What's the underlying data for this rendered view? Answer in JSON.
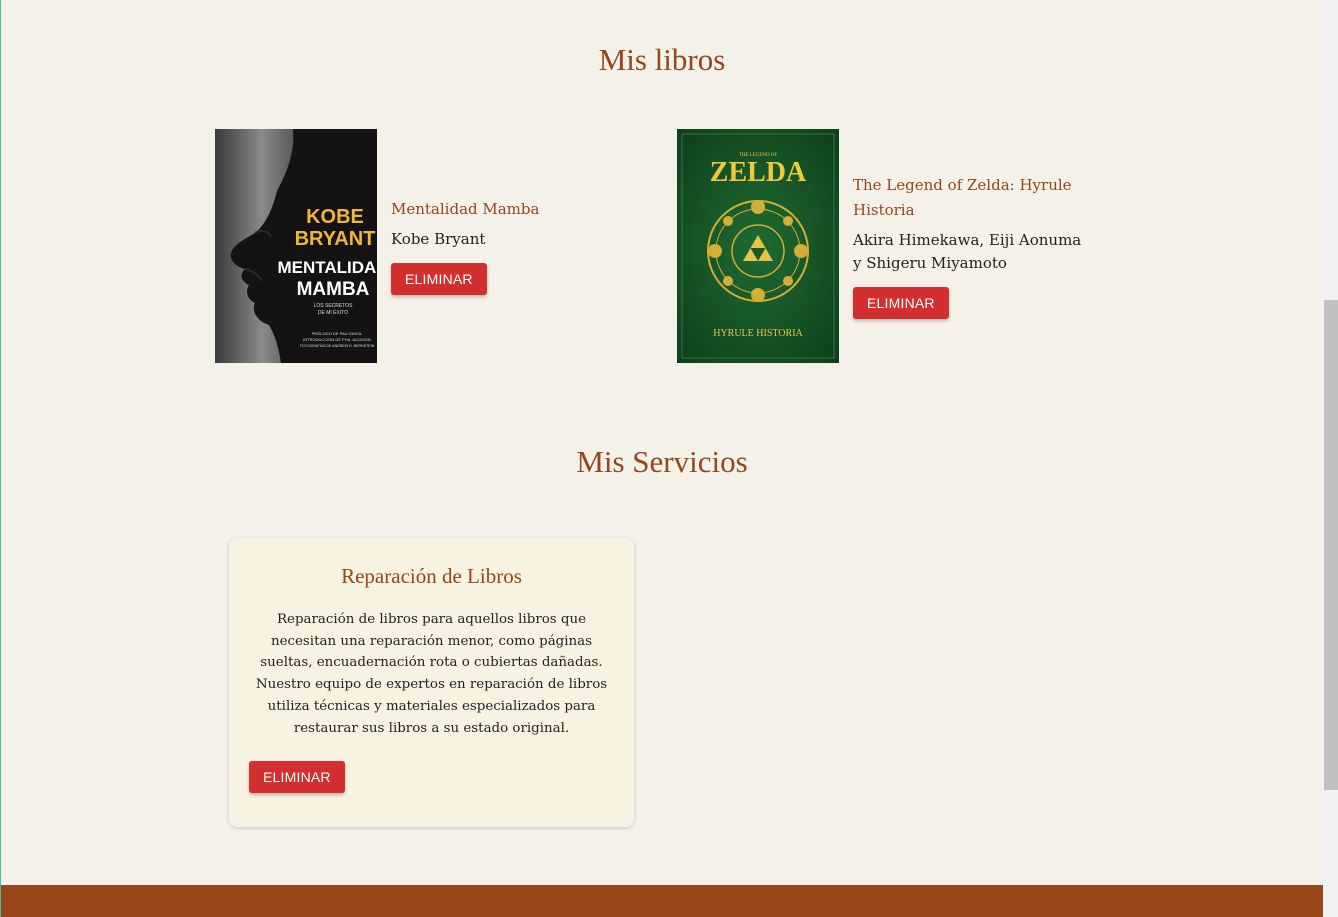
{
  "books_section": {
    "title": "Mis libros",
    "books": [
      {
        "title": "Mentalidad Mamba",
        "author": "Kobe Bryant",
        "button": "ELIMINAR",
        "cover": {
          "name_line1": "KOBE",
          "name_line2": "BRYANT",
          "title_line1": "MENTALIDAD",
          "title_line2": "MAMBA",
          "subtitle_line1": "LOS SECRETOS",
          "subtitle_line2": "DE MI ÉXITO",
          "credits_line1": "PRÓLOGO DE PAU GASOL",
          "credits_line2": "INTRODUCCIÓN DE PHIL JACKSON",
          "credits_line3": "FOTOGRAFÍAS DE ANDREW D. BERNSTEIN"
        }
      },
      {
        "title": "The Legend of Zelda: Hyrule Historia",
        "author": "Akira Himekawa, Eiji Aonuma y Shigeru Miyamoto",
        "button": "ELIMINAR",
        "cover": {
          "top_text": "THE LEGEND OF",
          "logo": "ZELDA",
          "bottom_text": "HYRULE HISTORIA"
        }
      }
    ]
  },
  "services_section": {
    "title": "Mis Servicios",
    "services": [
      {
        "title": "Reparación de Libros",
        "description": "Reparación de libros para aquellos libros que necesitan una reparación menor, como páginas sueltas, encuadernación rota o cubiertas dañadas. Nuestro equipo de expertos en reparación de libros utiliza técnicas y materiales especializados para restaurar sus libros a su estado original.",
        "button": "ELIMINAR"
      }
    ]
  },
  "colors": {
    "background": "#f4f1e9",
    "accent": "#96461b",
    "danger": "#d32f2f",
    "card": "#f8f2e3",
    "footer": "#984718"
  }
}
